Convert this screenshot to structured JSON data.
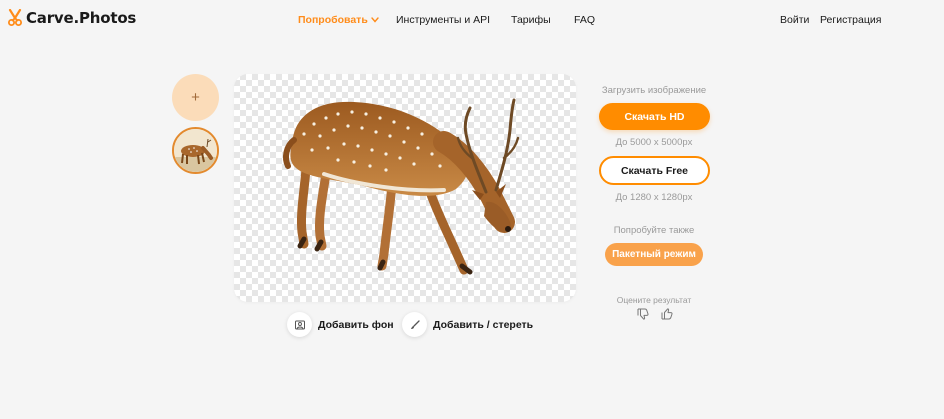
{
  "header": {
    "logo_text": "Carve.Photos",
    "nav": {
      "try": "Попробовать",
      "tools_api": "Инструменты и API",
      "prices": "Тарифы",
      "faq": "FAQ"
    },
    "login": "Войти",
    "register": "Регистрация"
  },
  "thumbnails": {
    "add_label": "+"
  },
  "tools": {
    "add_background": "Добавить фон",
    "add_erase": "Добавить / стереть"
  },
  "download": {
    "upload_label": "Загрузить изображение",
    "hd_button": "Скачать HD",
    "hd_size": "До 5000 x 5000px",
    "free_button": "Скачать Free",
    "free_size": "До 1280 x 1280px"
  },
  "also": {
    "label": "Попробуйте также",
    "batch_button": "Пакетный режим"
  },
  "rating": {
    "label": "Оцените результат"
  },
  "colors": {
    "accent": "#ff8c00",
    "accent_light": "#f9a24b",
    "thumb_bg": "#fbdcb9",
    "page_bg": "#f5f5f5"
  },
  "icons": {
    "logo": "scissors-icon",
    "nav_dropdown": "chevron-down-icon",
    "add_background": "image-layers-icon",
    "add_erase": "brush-icon",
    "dislike": "thumbs-down-icon",
    "like": "thumbs-up-icon"
  }
}
